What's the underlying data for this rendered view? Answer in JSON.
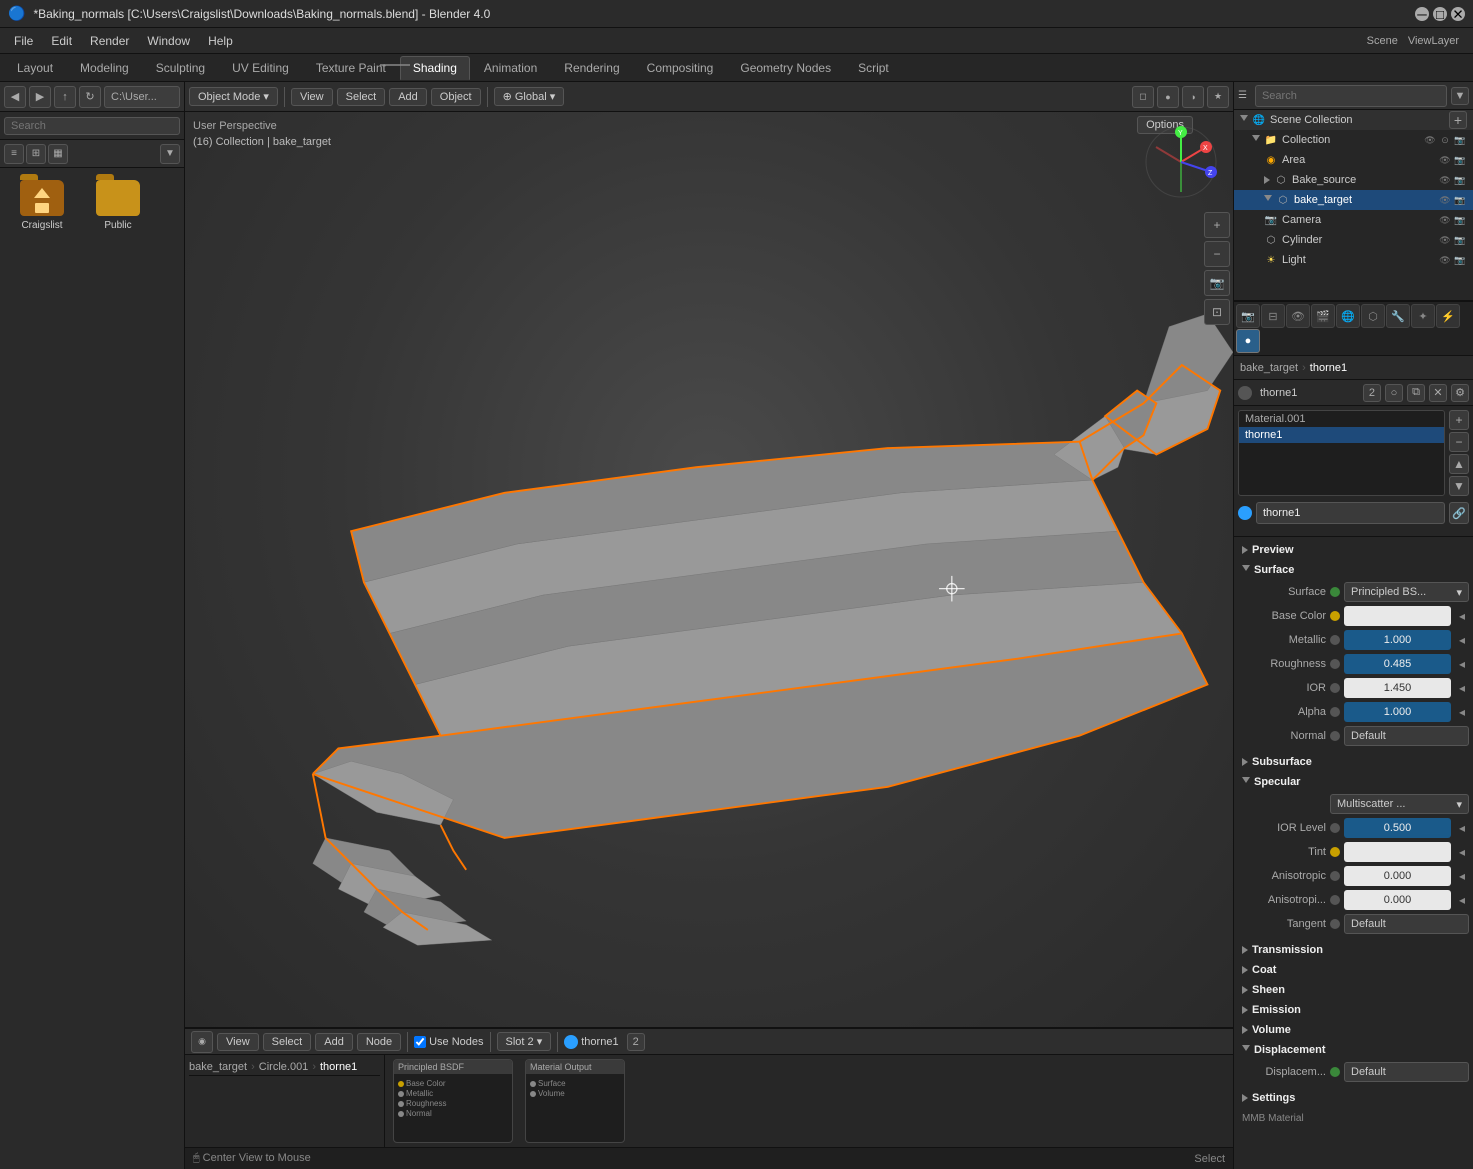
{
  "window": {
    "title": "*Baking_normals [C:\\Users\\Craigslist\\Downloads\\Baking_normals.blend] - Blender 4.0"
  },
  "menu": {
    "items": [
      "File",
      "Edit",
      "Render",
      "Window",
      "Help"
    ]
  },
  "workspace_tabs": {
    "tabs": [
      "Layout",
      "Modeling",
      "Sculpting",
      "UV Editing",
      "Texture Paint",
      "Shading",
      "Animation",
      "Rendering",
      "Compositing",
      "Geometry Nodes",
      "Script"
    ],
    "active": "Shading"
  },
  "viewport": {
    "mode": "Object Mode",
    "label": "User Perspective",
    "breadcrumb": "(16) Collection | bake_target",
    "options_label": "Options",
    "toolbar": {
      "view_label": "View",
      "select_label": "Select",
      "add_label": "Add",
      "object_label": "Object",
      "global_label": "Global"
    }
  },
  "node_editor": {
    "toolbar": {
      "view_label": "View",
      "select_label": "Select",
      "add_label": "Add",
      "node_label": "Node",
      "use_nodes_label": "Use Nodes",
      "slot_label": "Slot 2",
      "material_label": "thorne1"
    },
    "breadcrumb": {
      "items": [
        "bake_target",
        "Circle.001",
        "thorne1"
      ]
    },
    "cards": [
      {
        "id": "card1",
        "header": "Principled BSDF"
      },
      {
        "id": "card2",
        "header": "Material Output"
      }
    ]
  },
  "outliner": {
    "search_placeholder": "Search",
    "scene_collection_label": "Scene Collection",
    "items": [
      {
        "id": "collection",
        "name": "Collection",
        "indent": 1,
        "type": "collection",
        "expanded": true
      },
      {
        "id": "area",
        "name": "Area",
        "indent": 2,
        "type": "light"
      },
      {
        "id": "bake_source",
        "name": "Bake_source",
        "indent": 2,
        "type": "mesh"
      },
      {
        "id": "bake_target",
        "name": "bake_target",
        "indent": 2,
        "type": "mesh",
        "active": true
      },
      {
        "id": "camera",
        "name": "Camera",
        "indent": 2,
        "type": "camera"
      },
      {
        "id": "cylinder",
        "name": "Cylinder",
        "indent": 2,
        "type": "mesh"
      },
      {
        "id": "light",
        "name": "Light",
        "indent": 2,
        "type": "light"
      }
    ]
  },
  "properties": {
    "breadcrumb": {
      "items": [
        "bake_target",
        "thorne1"
      ]
    },
    "material_slot": {
      "items": [
        "Material.001"
      ],
      "active": "thorne1",
      "active_input": "thorne1"
    },
    "mat_name_bar": {
      "name_label": "thorne1",
      "count": "2"
    },
    "sections": {
      "preview": {
        "label": "Preview",
        "expanded": false
      },
      "surface": {
        "label": "Surface",
        "expanded": true,
        "surface_type": "Principled BS...",
        "properties": {
          "base_color": {
            "label": "Base Color",
            "value": ""
          },
          "metallic": {
            "label": "Metallic",
            "value": "1.000"
          },
          "roughness": {
            "label": "Roughness",
            "value": "0.485"
          },
          "ior": {
            "label": "IOR",
            "value": "1.450"
          },
          "alpha": {
            "label": "Alpha",
            "value": "1.000"
          },
          "normal": {
            "label": "Normal",
            "value": "Default"
          }
        }
      },
      "subsurface": {
        "label": "Subsurface",
        "expanded": false
      },
      "specular": {
        "label": "Specular",
        "expanded": true,
        "type": "Multiscatter ...",
        "properties": {
          "ior_level": {
            "label": "IOR Level",
            "value": "0.500"
          },
          "tint": {
            "label": "Tint",
            "value": ""
          },
          "anisotropic": {
            "label": "Anisotropic",
            "value": "0.000"
          },
          "anisotropi2": {
            "label": "Anisotropi...",
            "value": "0.000"
          },
          "tangent": {
            "label": "Tangent",
            "value": "Default"
          }
        }
      },
      "transmission": {
        "label": "Transmission",
        "expanded": false
      },
      "coat": {
        "label": "Coat",
        "expanded": false
      },
      "sheen": {
        "label": "Sheen",
        "expanded": false
      },
      "emission": {
        "label": "Emission",
        "expanded": false
      },
      "volume": {
        "label": "Volume",
        "expanded": false
      },
      "displacement": {
        "label": "Displacement",
        "expanded": true,
        "value": "Default"
      },
      "settings": {
        "label": "Settings",
        "expanded": false
      }
    }
  },
  "file_browser": {
    "items": [
      {
        "id": "home",
        "label": "Craigslist",
        "type": "home"
      },
      {
        "id": "public",
        "label": "Public",
        "type": "folder"
      }
    ],
    "path": "C:\\User..."
  },
  "status_bar": {
    "left": "Center View to Mouse",
    "right": "Select"
  }
}
